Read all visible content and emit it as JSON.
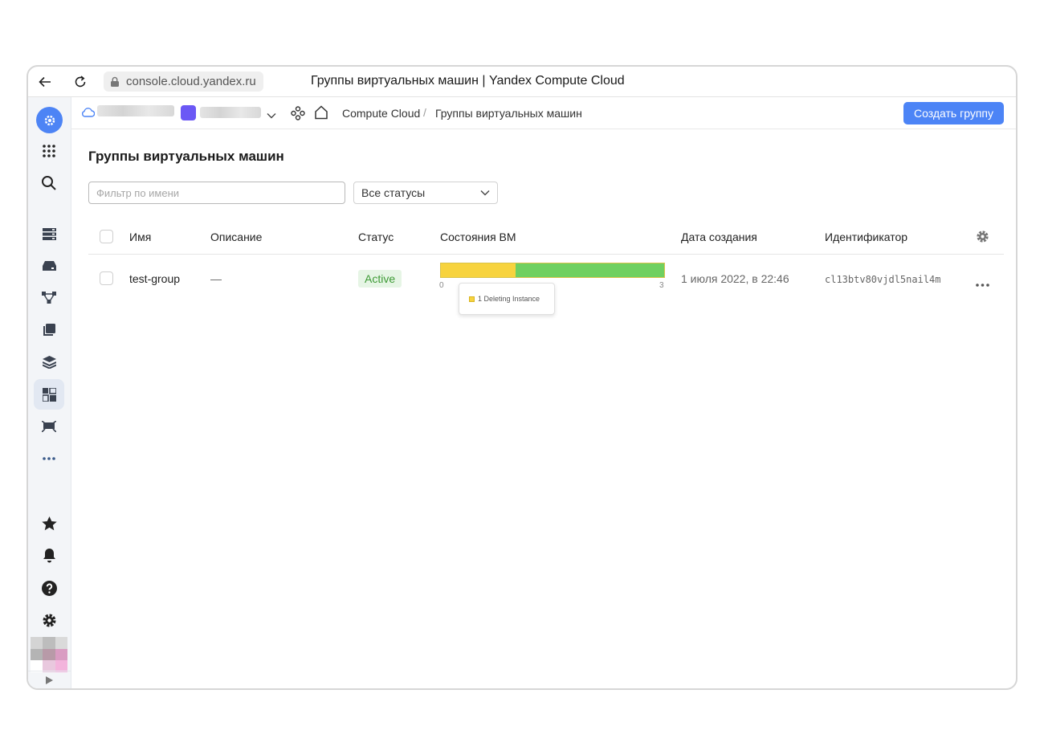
{
  "browser": {
    "url": "console.cloud.yandex.ru",
    "tab_title": "Группы виртуальных машин | Yandex Compute Cloud"
  },
  "topbar": {
    "breadcrumbs": [
      "Compute Cloud",
      "Группы виртуальных машин"
    ],
    "breadcrumb_separator": "/",
    "create_button": "Создать группу"
  },
  "page": {
    "heading": "Группы виртуальных машин",
    "filter_placeholder": "Фильтр по имени",
    "status_filter": "Все статусы"
  },
  "table": {
    "columns": [
      "Имя",
      "Описание",
      "Статус",
      "Состояния ВМ",
      "Дата создания",
      "Идентификатор"
    ],
    "rows": [
      {
        "name": "test-group",
        "description": "—",
        "status": "Active",
        "vm_states": {
          "min_label": "0",
          "max_label": "3",
          "segments": [
            {
              "label": "Deleting Instance",
              "count": 1,
              "color": "#f7d33e"
            },
            {
              "count": 2,
              "color": "#6fd060"
            }
          ],
          "tooltip": "1 Deleting Instance"
        },
        "created": "1  июля 2022, в 22:46",
        "id": "cl13btv80vjdl5nail4m"
      }
    ]
  },
  "colors": {
    "accent": "#4c84f6",
    "status_active_bg": "#e6f5e5",
    "status_active_text": "#3d9a35"
  }
}
